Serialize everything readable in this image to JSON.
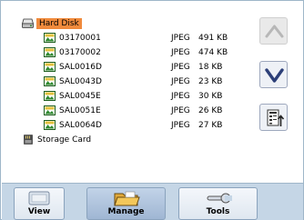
{
  "tree": {
    "root": {
      "label": "Hard Disk",
      "icon": "hard-disk-icon",
      "selected": true
    },
    "files": [
      {
        "name": "03170001",
        "type": "JPEG",
        "size": "491 KB",
        "icon": "image-file-icon"
      },
      {
        "name": "03170002",
        "type": "JPEG",
        "size": "474 KB",
        "icon": "image-file-icon"
      },
      {
        "name": "SAL0016D",
        "type": "JPEG",
        "size": "18 KB",
        "icon": "image-file-icon"
      },
      {
        "name": "SAL0043D",
        "type": "JPEG",
        "size": "23 KB",
        "icon": "image-file-icon"
      },
      {
        "name": "SAL0045E",
        "type": "JPEG",
        "size": "30 KB",
        "icon": "image-file-icon"
      },
      {
        "name": "SAL0051E",
        "type": "JPEG",
        "size": "26 KB",
        "icon": "image-file-icon"
      },
      {
        "name": "SAL0064D",
        "type": "JPEG",
        "size": "27 KB",
        "icon": "image-file-icon"
      }
    ],
    "storage_card": {
      "label": "Storage Card",
      "icon": "storage-card-icon"
    }
  },
  "side_buttons": {
    "up_icon": "chevron-up-icon",
    "down_icon": "chevron-down-icon",
    "info_icon": "file-info-icon"
  },
  "toolbar": {
    "view_label": "View",
    "manage_label": "Manage",
    "tools_label": "Tools",
    "active": "Manage"
  },
  "colors": {
    "selection": "#f08a3c",
    "toolbar_bg": "#c5d6e6",
    "active_tab": "#a9bedb"
  }
}
